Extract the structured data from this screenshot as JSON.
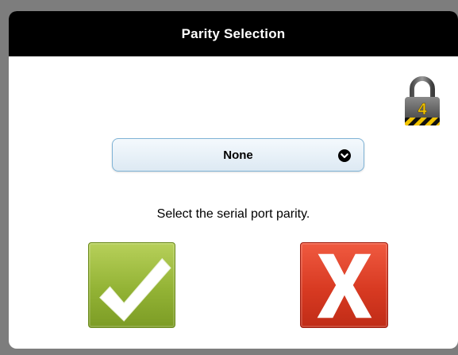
{
  "dialog": {
    "title": "Parity Selection",
    "lock": {
      "icon": "padlock-icon",
      "level": "4"
    },
    "parity_select": {
      "selected_value": "None",
      "chevron_icon": "chevron-down-circle-icon"
    },
    "instruction": "Select the serial port parity.",
    "confirm_button": {
      "icon": "checkmark-icon",
      "color": "#93b335"
    },
    "cancel_button": {
      "icon": "x-icon",
      "color": "#d83a22"
    }
  }
}
